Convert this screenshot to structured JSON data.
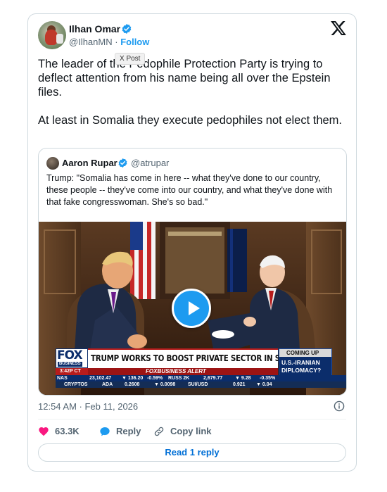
{
  "author": {
    "name": "Ilhan Omar",
    "handle": "@IlhanMN",
    "separator": "·",
    "follow_label": "Follow"
  },
  "tooltip": "X Post",
  "tweet_text": "The leader of the Pedophile Protection Party is trying to deflect attention from his name being all over the Epstein files.\n\nAt least in Somalia they execute pedophiles not elect them.",
  "quoted": {
    "name": "Aaron Rupar",
    "handle": "@atrupar",
    "text": "Trump: \"Somalia has come in here -- what they've done to our country, these people -- they've come into our country, and what they've done with that fake congresswoman. She's so bad.\""
  },
  "video": {
    "network_logo": "FOX",
    "network_sub": "BUSINESS",
    "headline": "TRUMP WORKS TO BOOST PRIVATE SECTOR IN SECOND TERM",
    "time": "3:42P CT",
    "alert": "FOXBUSINESS ALERT",
    "coming_up_label": "COMING UP",
    "coming_up_text": "U.S.-IRANIAN DIPLOMACY?",
    "ticker_row1": {
      "nas_label": "NAS",
      "nas_value": "23,102.47",
      "nas_change": "▼ 136.20",
      "nas_pct": "-0.59%",
      "russ_label": "RUSS 2K",
      "russ_value": "2,679.77",
      "russ_change": "▼ 9.28",
      "russ_pct": "-0.35%"
    },
    "ticker_row2": {
      "label": "CRYPTOS",
      "ada_label": "ADA",
      "ada_value": "0.2608",
      "ada_change": "▼ 0.0098",
      "sui_label": "SUI/USD",
      "sui_value": "0.921",
      "sui_change": "▼ 0.04"
    },
    "play_icon": "play-icon"
  },
  "timestamp": "12:54 AM · Feb 11, 2026",
  "actions": {
    "likes": "63.3K",
    "reply_label": "Reply",
    "copy_link_label": "Copy link"
  },
  "read_replies_label": "Read 1 reply",
  "colors": {
    "accent": "#1d9bf0",
    "like": "#f91880",
    "text": "#0f1419",
    "muted": "#536471",
    "border": "#cfd9de"
  }
}
